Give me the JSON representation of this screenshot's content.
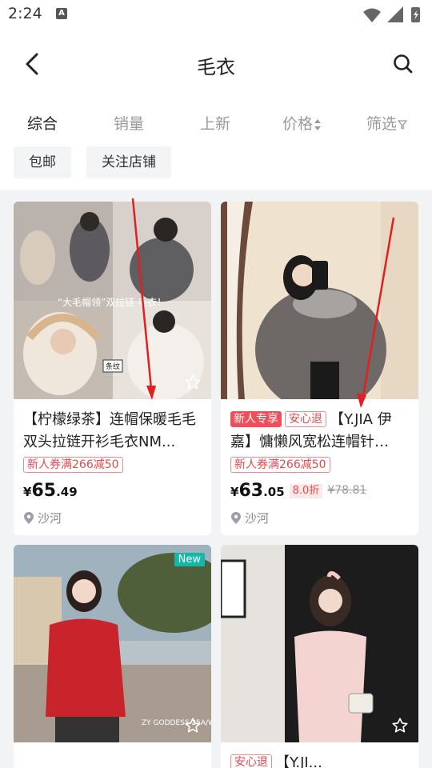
{
  "status_bar": {
    "time": "2:24",
    "notif_letter": "A"
  },
  "header": {
    "title": "毛衣"
  },
  "sort_tabs": [
    {
      "label": "综合",
      "active": true
    },
    {
      "label": "销量",
      "active": false
    },
    {
      "label": "上新",
      "active": false
    },
    {
      "label": "价格",
      "active": false
    },
    {
      "label": "筛选",
      "active": false
    }
  ],
  "chips": [
    "包邮",
    "关注店铺"
  ],
  "products": [
    {
      "title": "【柠檬绿茶】连帽保暖毛毛双头拉链开衫毛衣NM...",
      "coupon": "新人券满266减50",
      "price_currency": "¥",
      "price_int": "65",
      "price_dec": ".49",
      "location": "沙河"
    },
    {
      "tag_new": "新人专享",
      "tag_safe": "安心退",
      "title": "【Y.JIA 伊嘉】慵懒风宽松连帽针…",
      "coupon": "新人券满266减50",
      "price_currency": "¥",
      "price_int": "63",
      "price_dec": ".05",
      "discount": "8.0折",
      "orig_price": "¥78.81",
      "location": "沙河"
    },
    {
      "badge": "New"
    },
    {
      "tag_safe": "安心退",
      "title": "【Y.JI..."
    }
  ],
  "image_text": {
    "p1_overlay_top": "“大毛帽领”双拉链 毛衣！",
    "p1_sticker": "条纹",
    "p3_caption": "ZY GODDESS 25A/W"
  },
  "colors": {
    "accent_red": "#e5484f",
    "new_badge": "#14b8a6",
    "background": "#f2f3f5"
  }
}
